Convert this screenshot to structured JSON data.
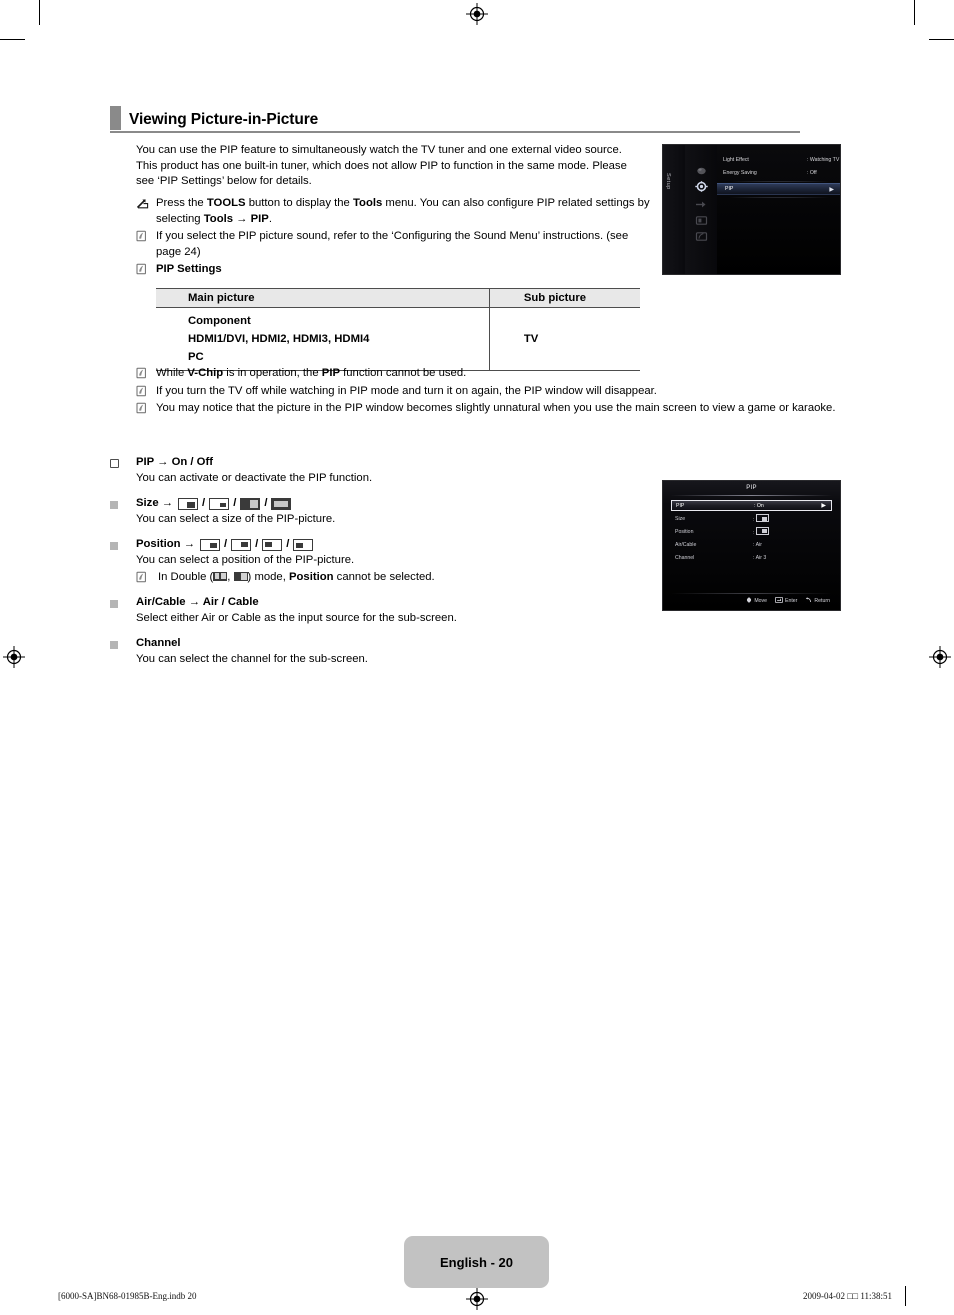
{
  "document": {
    "section_title": "Viewing Picture-in-Picture",
    "page_label": "English - 20",
    "footer_left": "[6000-SA]BN68-01985B-Eng.indb   20",
    "footer_right": "2009-04-02   □□ 11:38:51"
  },
  "intro": {
    "paragraph": "You can use the PIP feature to simultaneously watch the TV tuner and one external video source. This product has one built-in tuner, which does not allow PIP to function in the same mode. Please see ‘PIP Settings’ below for details."
  },
  "notes_top": [
    {
      "icon": "tools-icon",
      "text_1": "Press the ",
      "bold_1": "TOOLS",
      "text_2": " button to display the ",
      "bold_2": "Tools",
      "text_3": " menu. You can also configure PIP related settings by selecting ",
      "bold_3": "Tools → PIP",
      "text_4": "."
    },
    {
      "icon": "note-icon",
      "text_1": "If you select the PIP picture sound, refer to the ‘Configuring the Sound Menu’ instructions. (see page 24)"
    },
    {
      "icon": "note-icon",
      "bold_1": "PIP Settings"
    }
  ],
  "pip_table": {
    "headers": [
      "Main picture",
      "Sub picture"
    ],
    "main_rows": [
      "Component",
      "HDMI1/DVI, HDMI2, HDMI3, HDMI4",
      "PC"
    ],
    "sub_value": "TV"
  },
  "notes_after": [
    {
      "icon": "note-icon",
      "text_1": "While ",
      "bold_1": "V-Chip",
      "text_2": " is in operation, the ",
      "bold_2": "PIP",
      "text_3": " function cannot be used."
    },
    {
      "icon": "note-icon",
      "text_1": "If you turn the TV off while watching in PIP mode and turn it on again, the PIP window will disappear."
    },
    {
      "icon": "note-icon",
      "text_1": "You may notice that the picture in the PIP window becomes slightly unnatural when you use the main screen to view a game or karaoke."
    }
  ],
  "options": [
    {
      "marker": "open-square",
      "title": "PIP → On / Off",
      "description": "You can activate or deactivate the PIP function."
    },
    {
      "marker": "filled-square",
      "title_prefix": "Size →",
      "icons": [
        "size-large",
        "size-small",
        "double-wide-1",
        "double-wide-2"
      ],
      "description": "You can select a size of the PIP-picture."
    },
    {
      "marker": "filled-square",
      "title_prefix": "Position →",
      "icons": [
        "pos-bottom-right",
        "pos-top-right",
        "pos-top-left",
        "pos-bottom-left"
      ],
      "description": "You can select a position of the PIP-picture.",
      "subnote": {
        "icon": "note-icon",
        "text_1": "In Double (",
        "text_2": ", ",
        "text_3": ") mode, ",
        "bold_1": "Position",
        "text_4": " cannot be selected."
      }
    },
    {
      "marker": "filled-square",
      "title": "Air/Cable → Air / Cable",
      "description": "Select either Air or Cable as the input source for the sub-screen."
    },
    {
      "marker": "filled-square",
      "title": "Channel",
      "description": "You can select the channel for the sub-screen."
    }
  ],
  "osd_setup": {
    "rail_label": "Setup",
    "rows": [
      {
        "label": "Light Effect",
        "value": ": Watching TV",
        "highlight": false
      },
      {
        "label": "Energy Saving",
        "value": ": Off",
        "highlight": false
      },
      {
        "label": "PIP",
        "value": "",
        "highlight": true,
        "arrow": "▶"
      }
    ]
  },
  "osd_pip": {
    "title": "PIP",
    "rows": [
      {
        "label": "PIP",
        "value": ": On",
        "selected": true,
        "arrow": "▶"
      },
      {
        "label": "Size",
        "value": ":",
        "icon": "size-box",
        "selected": false
      },
      {
        "label": "Position",
        "value": ":",
        "icon": "pos-box",
        "selected": false
      },
      {
        "label": "Air/Cable",
        "value": ": Air",
        "selected": false
      },
      {
        "label": "Channel",
        "value": ": Air 3",
        "selected": false
      }
    ],
    "footer": [
      {
        "icon": "move-icon",
        "label": "Move"
      },
      {
        "icon": "enter-icon",
        "label": "Enter"
      },
      {
        "icon": "return-icon",
        "label": "Return"
      }
    ]
  }
}
